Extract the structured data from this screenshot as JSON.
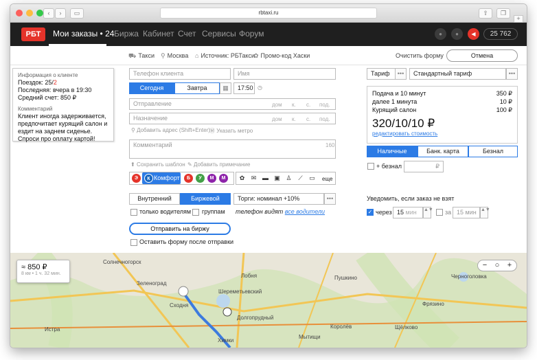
{
  "browser": {
    "url": "rbtaxi.ru"
  },
  "nav": {
    "logo": "РБТ",
    "my_orders": "Мои заказы • 24",
    "items": [
      "Биржа",
      "Кабинет",
      "Счет",
      "Сервисы",
      "Форум"
    ],
    "balance": "25 762"
  },
  "subbar": {
    "taxi": "Такси",
    "city": "Москва",
    "source": "Источник: РБТакси",
    "promo": "Промо-код Хаски",
    "clear": "Очистить форму",
    "cancel": "Отмена"
  },
  "client_info": {
    "title": "Информация о клиенте",
    "trips_label": "Поездок: 25/",
    "trips_red": "2",
    "last": "Последняя: вчера в 19:30",
    "avg": "Средний счет: 850 ₽",
    "comment_title": "Комментарий",
    "comment": "Клиент иногда задерживается, предпочитает курящий салон и ездит на заднем сиденье. Спроси про оплату картой!"
  },
  "form": {
    "phone_placeholder": "Телефон клиента",
    "name_placeholder": "Имя",
    "today": "Сегодня",
    "tomorrow": "Завтра",
    "time": "17:50",
    "from_placeholder": "Отправление",
    "to_placeholder": "Назначение",
    "addr_fields": [
      "дом",
      "к.",
      "с.",
      "под."
    ],
    "add_address": "Добавить адрес (Shift+Enter)",
    "metro": "Указать метро",
    "comment_placeholder": "Комментарий",
    "comment_counter": "160",
    "save_template": "Сохранить шаблон",
    "add_note": "Добавить примечание",
    "comfort": "Комфорт",
    "class_letters": [
      "Э",
      "К",
      "Б",
      "У",
      "М",
      "М"
    ],
    "more": "еще",
    "internal": "Внутренний",
    "exchange": "Биржевой",
    "auction": "Торги: номинал +10%",
    "only_drivers": "только водителям",
    "groups": "группам",
    "phone_visible": "телефон видят",
    "all_drivers": "все водители",
    "send": "Отправить на биржу",
    "keep_form": "Оставить форму после отправки"
  },
  "tariff": {
    "label": "Тариф",
    "value": "Стандартный тариф",
    "rows": [
      {
        "name": "Подача и 10 минут",
        "price": "350 ₽"
      },
      {
        "name": "далее 1 минута",
        "price": "10 ₽"
      },
      {
        "name": "Курящий салон",
        "price": "100 ₽"
      }
    ],
    "total": "320/10/10 ₽",
    "edit": "редактировать стоимость",
    "payment": [
      "Наличные",
      "Банк. карта",
      "Безнал"
    ],
    "cashless": "+ безнал",
    "currency": "₽"
  },
  "notify": {
    "title": "Уведомить, если заказ не взят",
    "after": "через",
    "after_value": "15",
    "in": "за",
    "in_value": "15",
    "unit": "мин"
  },
  "map": {
    "estimate": "≈ 850 ₽",
    "estimate_sub": "8 км • 1 ч. 32 мин.",
    "labels": [
      "Зеленоград",
      "Солнечногорск",
      "Лобня",
      "Пушкино",
      "Щёлково",
      "Химки",
      "Истра",
      "Королёв",
      "Мытищи",
      "Долгопрудный",
      "Сходня",
      "Шереметьевский",
      "Черноголовка",
      "Фрязино"
    ]
  }
}
